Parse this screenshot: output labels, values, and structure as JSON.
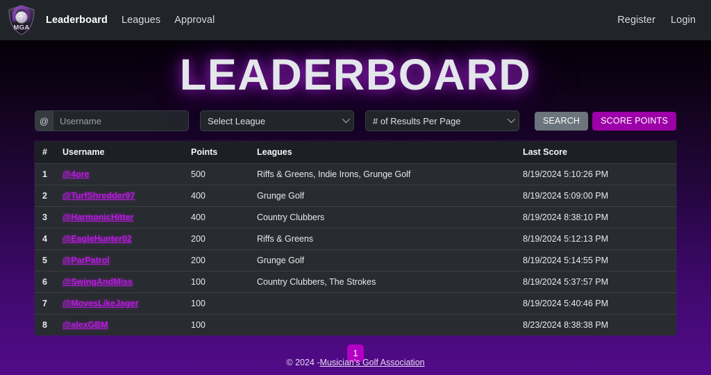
{
  "navbar": {
    "brand_text": "MGA",
    "brand_icon": "mga-shield-logo",
    "links": [
      {
        "label": "Leaderboard",
        "active": true
      },
      {
        "label": "Leagues",
        "active": false
      },
      {
        "label": "Approval",
        "active": false
      }
    ],
    "right_links": [
      {
        "label": "Register"
      },
      {
        "label": "Login"
      }
    ]
  },
  "hero": {
    "title": "LEADERBOARD"
  },
  "filters": {
    "username_addon": "@",
    "username_placeholder": "Username",
    "username_value": "",
    "league_selected": "Select League",
    "results_selected": "# of Results Per Page",
    "search_label": "SEARCH",
    "score_points_label": "SCORE POINTS"
  },
  "table": {
    "headers": [
      "#",
      "Username",
      "Points",
      "Leagues",
      "Last Score"
    ],
    "rows": [
      {
        "rank": "1",
        "username": "@4ore",
        "points": "500",
        "leagues": "Riffs & Greens, Indie Irons, Grunge Golf",
        "last_score": "8/19/2024 5:10:26 PM"
      },
      {
        "rank": "2",
        "username": "@TurfShredder97",
        "points": "400",
        "leagues": "Grunge Golf",
        "last_score": "8/19/2024 5:09:00 PM"
      },
      {
        "rank": "3",
        "username": "@HarmonicHitter",
        "points": "400",
        "leagues": "Country Clubbers",
        "last_score": "8/19/2024 8:38:10 PM"
      },
      {
        "rank": "4",
        "username": "@EagleHunter02",
        "points": "200",
        "leagues": "Riffs & Greens",
        "last_score": "8/19/2024 5:12:13 PM"
      },
      {
        "rank": "5",
        "username": "@ParPatrol",
        "points": "200",
        "leagues": "Grunge Golf",
        "last_score": "8/19/2024 5:14:55 PM"
      },
      {
        "rank": "6",
        "username": "@SwingAndMiss",
        "points": "100",
        "leagues": "Country Clubbers, The Strokes",
        "last_score": "8/19/2024 5:37:57 PM"
      },
      {
        "rank": "7",
        "username": "@MovesLikeJager",
        "points": "100",
        "leagues": "",
        "last_score": "8/19/2024 5:40:46 PM"
      },
      {
        "rank": "8",
        "username": "@alexGBM",
        "points": "100",
        "leagues": "",
        "last_score": "8/23/2024 8:38:38 PM"
      }
    ]
  },
  "pagination": {
    "pages": [
      "1"
    ],
    "current": "1"
  },
  "footer": {
    "copyright": "© 2024 - ",
    "link_label": "Musician's Golf Association"
  },
  "colors": {
    "navbar_bg": "#212529",
    "table_header_bg": "#1c1f23",
    "table_row_bg": "#282c30",
    "accent_magenta": "#b300c4",
    "link_purple": "#b819e0",
    "search_grey": "#6c757d",
    "page_bottom_purple": "#520b88"
  }
}
